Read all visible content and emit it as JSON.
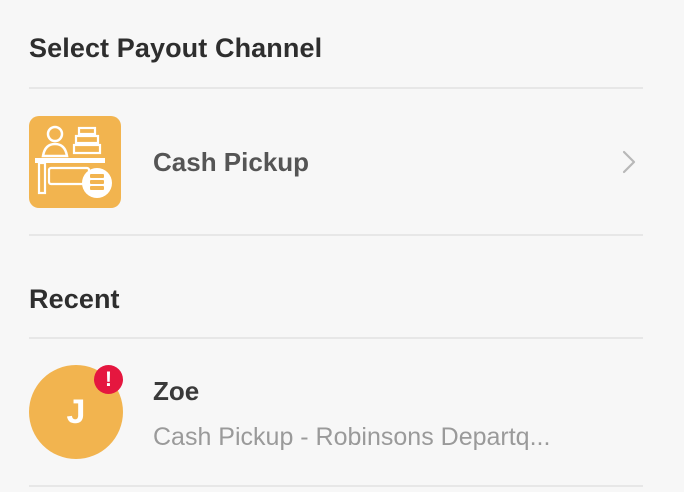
{
  "payout": {
    "title": "Select Payout Channel",
    "channels": [
      {
        "label": "Cash Pickup",
        "icon": "cash-pickup-icon"
      }
    ]
  },
  "recent": {
    "title": "Recent",
    "items": [
      {
        "initial": "J",
        "name": "Zoe",
        "detail": "Cash Pickup - Robinsons Departq...",
        "badge": "!"
      }
    ]
  },
  "colors": {
    "accent": "#f2b44f",
    "alert": "#e5173f",
    "background": "#f7f7f7",
    "divider": "#e7e7e7"
  }
}
